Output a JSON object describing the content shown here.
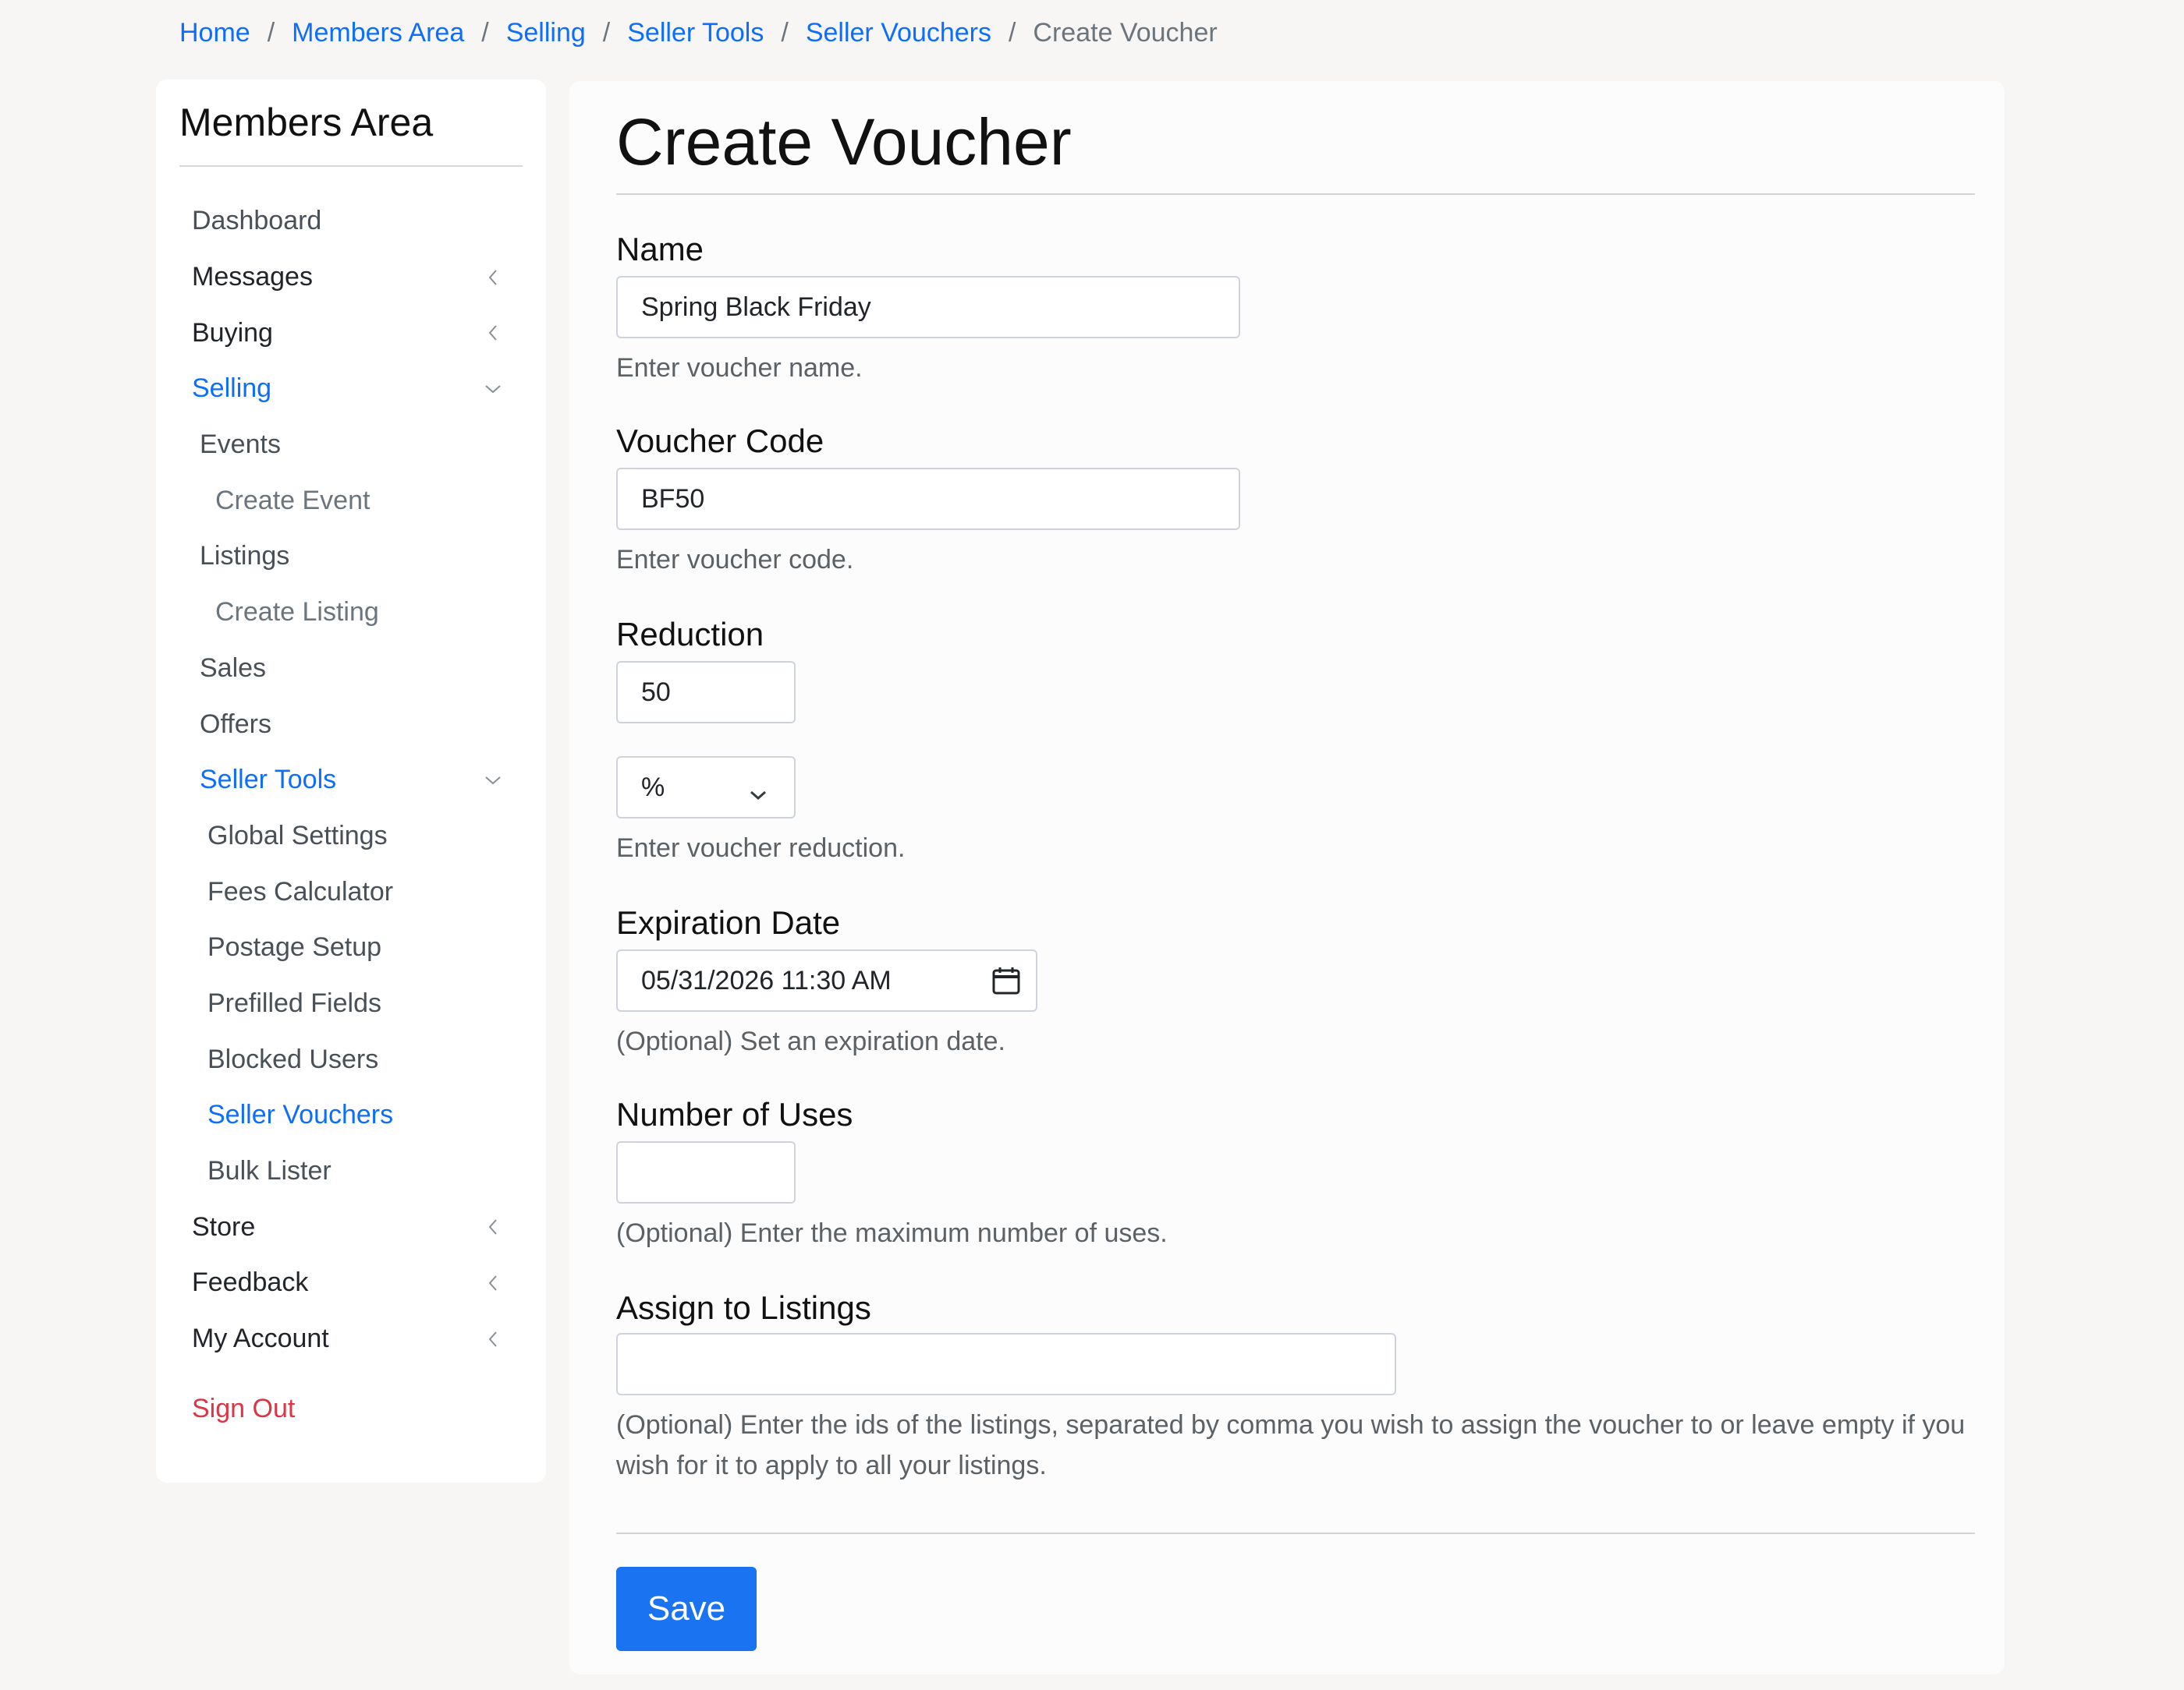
{
  "breadcrumb": {
    "items": [
      "Home",
      "Members Area",
      "Selling",
      "Seller Tools",
      "Seller Vouchers"
    ],
    "current": "Create Voucher",
    "separator": "/"
  },
  "sidebar": {
    "title": "Members Area",
    "items": {
      "dashboard": "Dashboard",
      "messages": "Messages",
      "buying": "Buying",
      "selling": "Selling",
      "events": "Events",
      "create_event": "Create Event",
      "listings": "Listings",
      "create_listing": "Create Listing",
      "sales": "Sales",
      "offers": "Offers",
      "seller_tools": "Seller Tools",
      "global_settings": "Global Settings",
      "fees_calculator": "Fees Calculator",
      "postage_setup": "Postage Setup",
      "prefilled_fields": "Prefilled Fields",
      "blocked_users": "Blocked Users",
      "seller_vouchers": "Seller Vouchers",
      "bulk_lister": "Bulk Lister",
      "store": "Store",
      "feedback": "Feedback",
      "my_account": "My Account",
      "sign_out": "Sign Out"
    }
  },
  "form": {
    "title": "Create Voucher",
    "name": {
      "label": "Name",
      "value": "Spring Black Friday",
      "help": "Enter voucher name."
    },
    "code": {
      "label": "Voucher Code",
      "value": "BF50",
      "help": "Enter voucher code."
    },
    "reduction": {
      "label": "Reduction",
      "value": "50",
      "unit": "%",
      "help": "Enter voucher reduction."
    },
    "expiration": {
      "label": "Expiration Date",
      "value": "05/31/2026 11:30 AM",
      "help": "(Optional) Set an expiration date."
    },
    "uses": {
      "label": "Number of Uses",
      "value": "",
      "help": "(Optional) Enter the maximum number of uses."
    },
    "listings": {
      "label": "Assign to Listings",
      "value": "",
      "help": "(Optional) Enter the ids of the listings, separated by comma you wish to assign the voucher to or leave empty if you wish for it to apply to all your listings."
    },
    "save_label": "Save"
  },
  "colors": {
    "link": "#0d6efd",
    "danger": "#dc3545",
    "primary_button": "#1a73f0"
  }
}
